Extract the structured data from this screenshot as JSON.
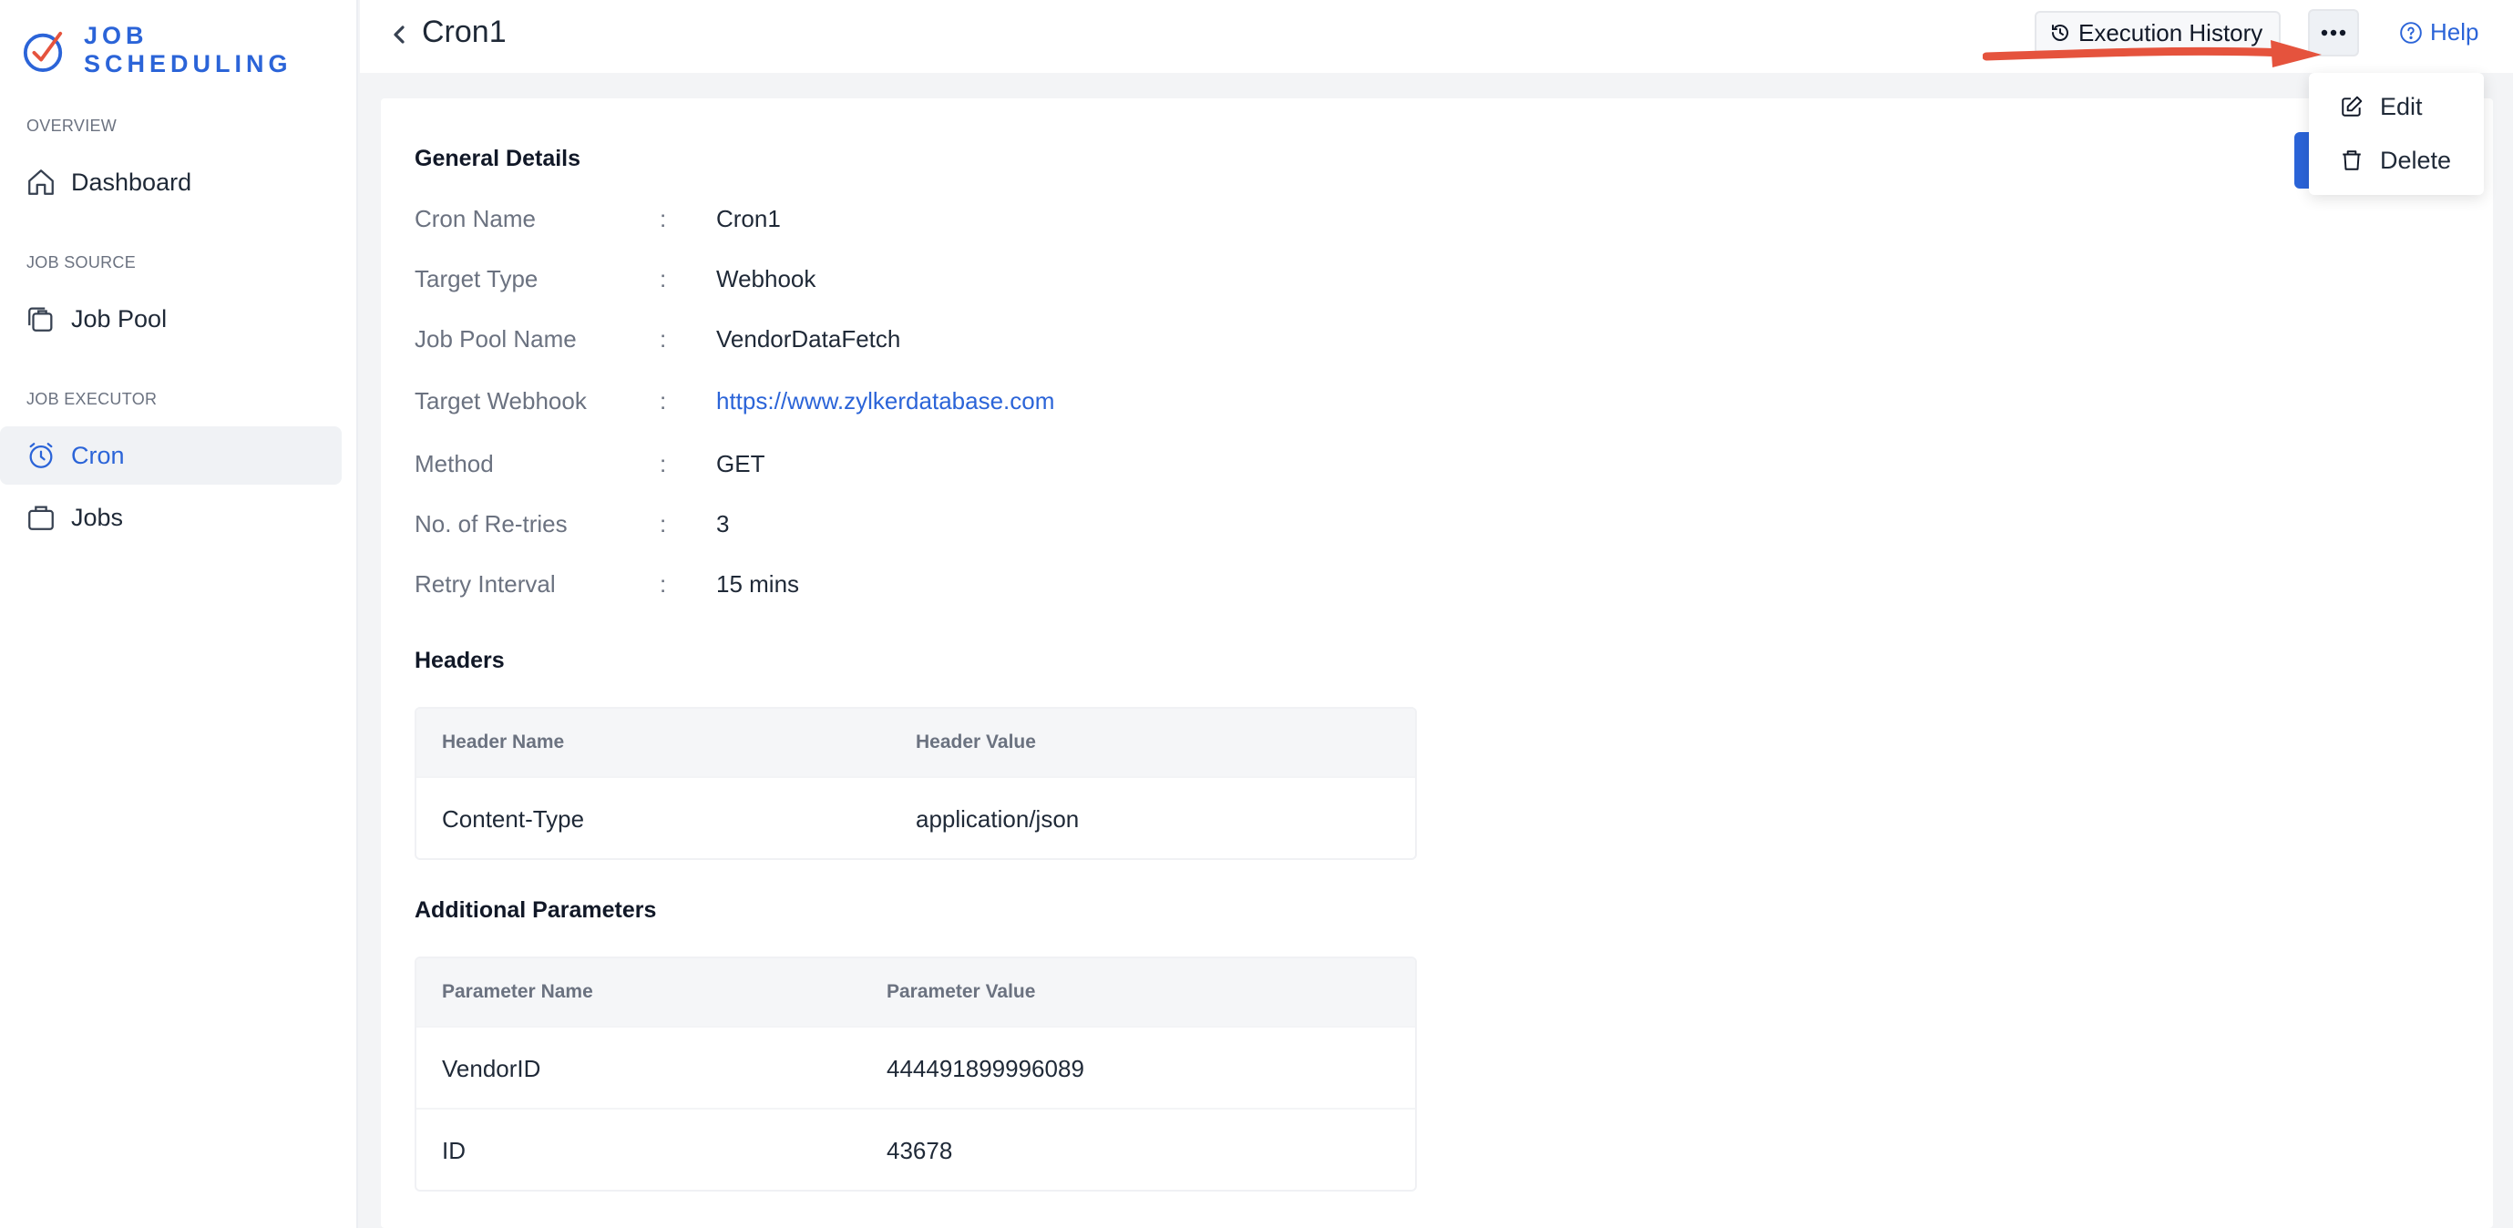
{
  "brand": {
    "name": "JOB SCHEDULING"
  },
  "sidebar": {
    "sections": [
      {
        "label": "OVERVIEW"
      },
      {
        "label": "JOB SOURCE"
      },
      {
        "label": "JOB EXECUTOR"
      }
    ],
    "items": [
      {
        "label": "Dashboard",
        "icon": "home-icon"
      },
      {
        "label": "Job Pool",
        "icon": "job-pool-icon"
      },
      {
        "label": "Cron",
        "icon": "alarm-clock-icon",
        "active": true
      },
      {
        "label": "Jobs",
        "icon": "briefcase-icon"
      }
    ]
  },
  "header": {
    "title": "Cron1",
    "execution_history_label": "Execution History",
    "help_label": "Help"
  },
  "menu": {
    "items": [
      {
        "label": "Edit",
        "icon": "edit-icon"
      },
      {
        "label": "Delete",
        "icon": "trash-icon"
      }
    ]
  },
  "general": {
    "title": "General Details",
    "colon": ":",
    "fields": [
      {
        "label": "Cron Name",
        "value": "Cron1"
      },
      {
        "label": "Target Type",
        "value": "Webhook"
      },
      {
        "label": "Job Pool Name",
        "value": "VendorDataFetch"
      },
      {
        "label": "Target Webhook",
        "value": "https://www.zylkerdatabase.com"
      },
      {
        "label": "Method",
        "value": "GET"
      },
      {
        "label": "No. of Re-tries",
        "value": "3"
      },
      {
        "label": "Retry Interval",
        "value": "15 mins"
      }
    ]
  },
  "headers": {
    "title": "Headers",
    "columns": [
      "Header Name",
      "Header Value"
    ],
    "rows": [
      [
        "Content-Type",
        "application/json"
      ]
    ]
  },
  "params": {
    "title": "Additional Parameters",
    "columns": [
      "Parameter Name",
      "Parameter Value"
    ],
    "rows": [
      [
        "VendorID",
        "444491899996089"
      ],
      [
        "ID",
        "43678"
      ]
    ]
  },
  "colors": {
    "accent": "#2b64d8",
    "annotation_arrow": "#e5533d",
    "active_bg": "#f0f2f5"
  }
}
